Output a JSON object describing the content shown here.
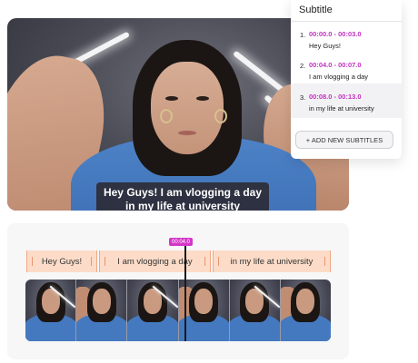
{
  "video": {
    "caption": "Hey Guys! I am vlogging a day in my life at university"
  },
  "subtitle_panel": {
    "title": "Subtitle",
    "items": [
      {
        "num": "1.",
        "time": "00:00.0 - 00:03.0",
        "text": "Hey Guys!"
      },
      {
        "num": "2.",
        "time": "00:04.0 - 00:07.0",
        "text": "I am vlogging a day"
      },
      {
        "num": "3.",
        "time": "00:08.0 - 00:13.0",
        "text": "in my life at university"
      }
    ],
    "add_button": "+ ADD NEW SUBTITLES",
    "accent_color": "#c232c0"
  },
  "timeline": {
    "playhead_time": "00:04.0",
    "segments": [
      {
        "label": "Hey Guys!"
      },
      {
        "label": "I am vlogging a day"
      },
      {
        "label": "in my life at university"
      }
    ],
    "segment_color": "#fcdcc8",
    "playhead_color": "#d437c8"
  }
}
